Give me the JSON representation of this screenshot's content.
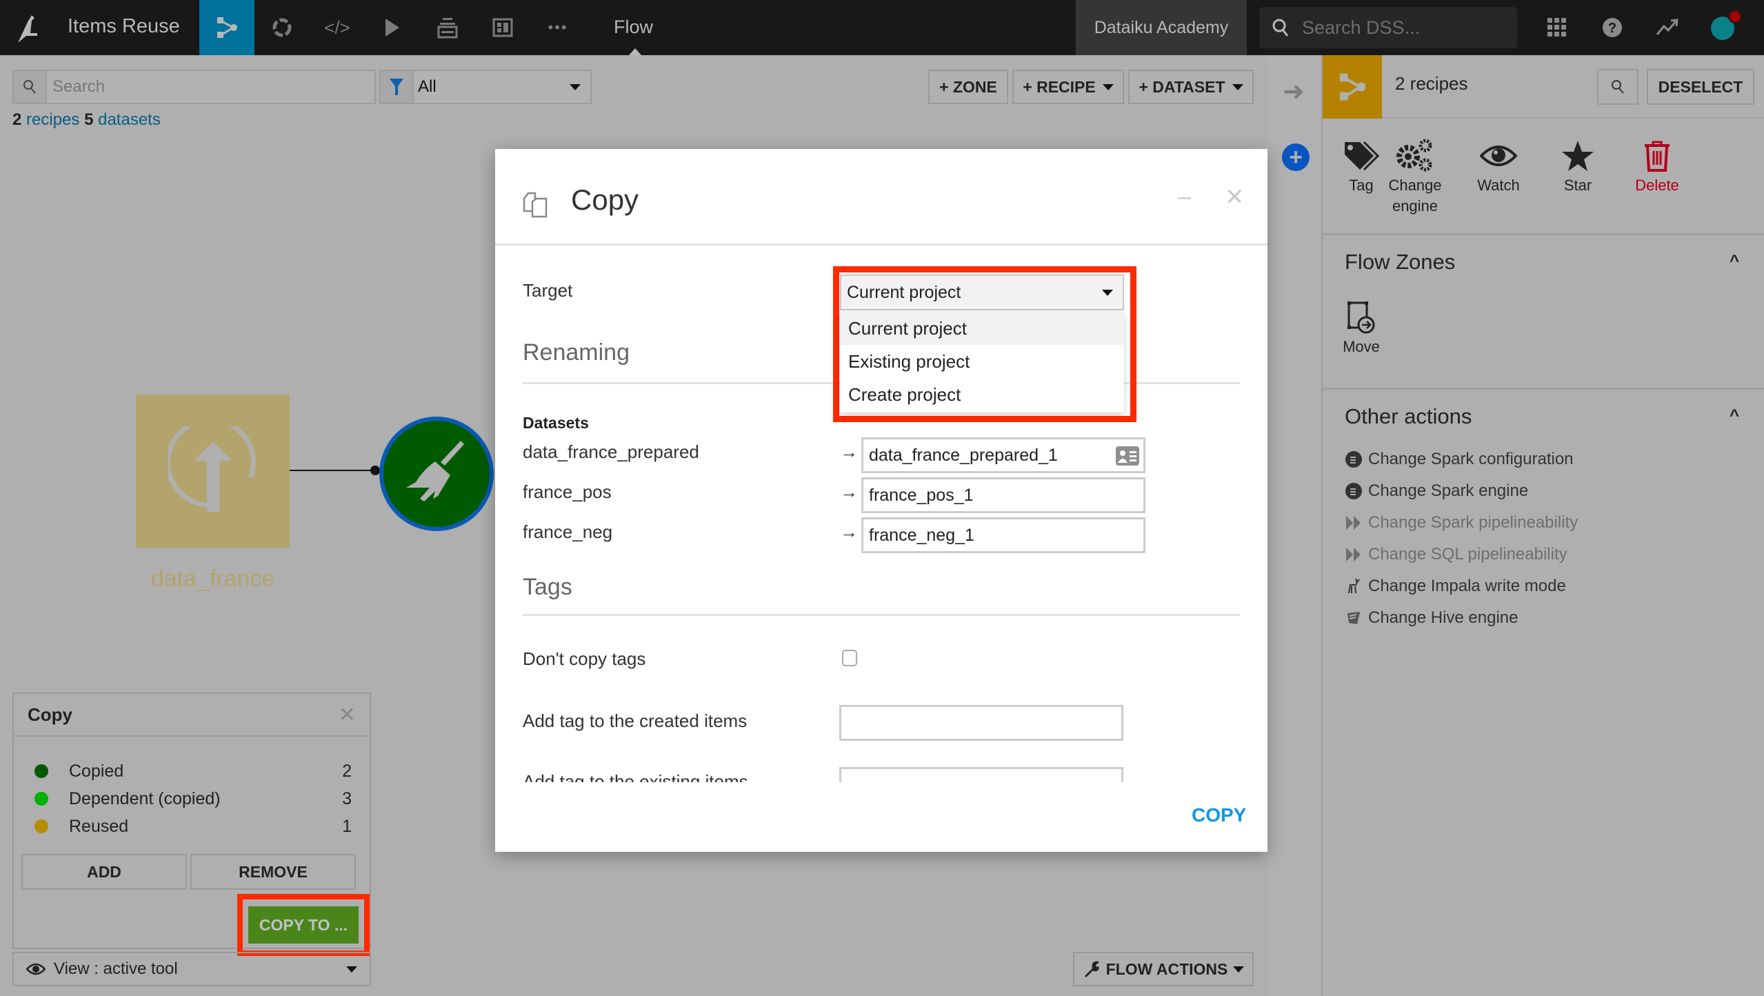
{
  "topbar": {
    "project_title": "Items Reuse",
    "nav_icons": [
      "flow-icon",
      "analysis-icon",
      "code-icon",
      "jobs-icon",
      "datasets-stack-icon",
      "dashboard-icon",
      "more-icon"
    ],
    "current_section": "Flow",
    "academy_label": "Dataiku Academy",
    "search_placeholder": "Search DSS...",
    "right_icons": [
      "apps-grid-icon",
      "help-icon",
      "activity-icon",
      "user-avatar"
    ]
  },
  "flow_toolbar": {
    "search_placeholder": "Search",
    "filter_value": "All",
    "zone_btn": "+ ZONE",
    "recipe_btn": "+ RECIPE",
    "dataset_btn": "+ DATASET"
  },
  "counts": {
    "recipes_num": "2",
    "recipes_label": "recipes",
    "datasets_num": "5",
    "datasets_label": "datasets"
  },
  "flow": {
    "dataset_name": "data_france",
    "recipe_type": "prepare"
  },
  "copy_panel": {
    "title": "Copy",
    "legend": [
      {
        "label": "Copied",
        "count": "2",
        "color": "#005a00"
      },
      {
        "label": "Dependent (copied)",
        "count": "3",
        "color": "#00b400"
      },
      {
        "label": "Reused",
        "count": "1",
        "color": "#b88c00"
      }
    ],
    "add_btn": "ADD",
    "remove_btn": "REMOVE",
    "copy_to_btn": "COPY TO ..."
  },
  "view_select": {
    "label": "View : active tool"
  },
  "flow_actions": {
    "label": "FLOW ACTIONS"
  },
  "right_panel": {
    "selection_title": "2 recipes",
    "deselect_btn": "DESELECT",
    "actions": [
      {
        "label": "Tag"
      },
      {
        "label": "Change engine"
      },
      {
        "label": "Watch"
      },
      {
        "label": "Star"
      },
      {
        "label": "Delete"
      }
    ],
    "flow_zones_title": "Flow Zones",
    "move_label": "Move",
    "other_actions_title": "Other actions",
    "other_actions": [
      {
        "label": "Change Spark configuration",
        "enabled": true
      },
      {
        "label": "Change Spark engine",
        "enabled": true
      },
      {
        "label": "Change Spark pipelineability",
        "enabled": false
      },
      {
        "label": "Change SQL pipelineability",
        "enabled": false
      },
      {
        "label": "Change Impala write mode",
        "enabled": true
      },
      {
        "label": "Change Hive engine",
        "enabled": true
      }
    ]
  },
  "modal": {
    "title": "Copy",
    "target_label": "Target",
    "target_value": "Current project",
    "target_options": [
      "Current project",
      "Existing project",
      "Create project"
    ],
    "renaming_title": "Renaming",
    "datasets_heading": "Datasets",
    "renames": [
      {
        "source": "data_france_prepared",
        "target": "data_france_prepared_1"
      },
      {
        "source": "france_pos",
        "target": "france_pos_1"
      },
      {
        "source": "france_neg",
        "target": "france_neg_1"
      }
    ],
    "arrow": "→",
    "tags_title": "Tags",
    "dont_copy_tags_label": "Don't copy tags",
    "dont_copy_tags_checked": false,
    "add_tag_created_label": "Add tag to the created items",
    "add_tag_created_value": "",
    "add_tag_existing_label": "Add tag to the existing items",
    "add_tag_existing_value": "",
    "copy_btn": "COPY"
  },
  "colors": {
    "accent_blue": "#00729b",
    "selection_gold": "#b48200",
    "copy_green": "#4a851a",
    "highlight_red": "#ff2a00",
    "link_blue": "#0b97ea",
    "delete_red": "#b3001a"
  }
}
